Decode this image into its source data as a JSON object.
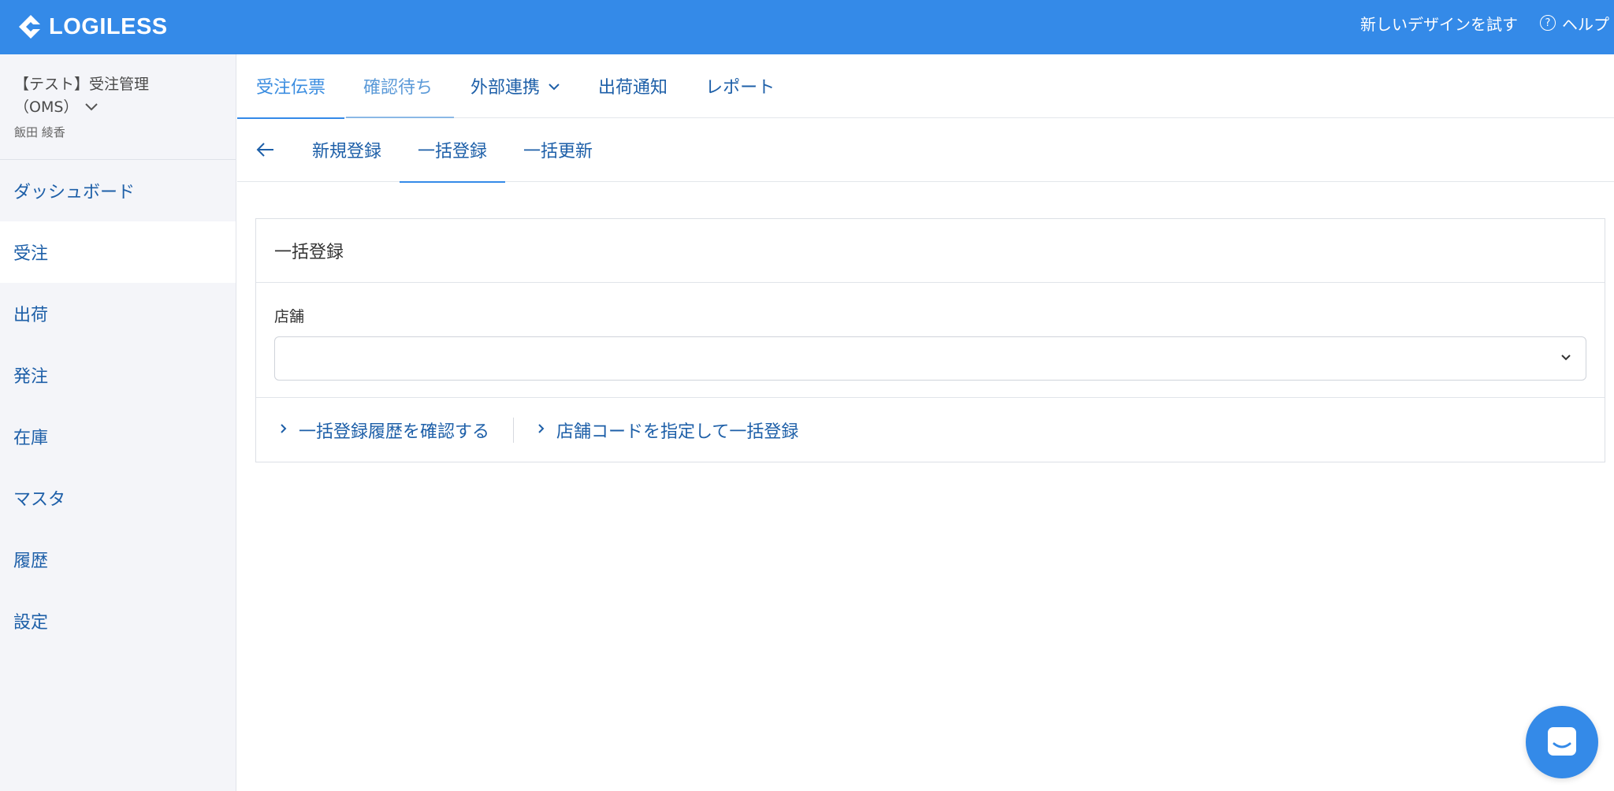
{
  "header": {
    "logo_text": "LOGILESS",
    "try_new_design": "新しいデザインを試す",
    "help_label": "ヘルプ",
    "help_icon": "?"
  },
  "sidebar": {
    "org_line1": "【テスト】受注管理",
    "org_line2": "（OMS）",
    "user": "飯田 綾香",
    "items": [
      {
        "label": "ダッシュボード"
      },
      {
        "label": "受注"
      },
      {
        "label": "出荷"
      },
      {
        "label": "発注"
      },
      {
        "label": "在庫"
      },
      {
        "label": "マスタ"
      },
      {
        "label": "履歴"
      },
      {
        "label": "設定"
      }
    ]
  },
  "tabs": [
    {
      "label": "受注伝票"
    },
    {
      "label": "確認待ち"
    },
    {
      "label": "外部連携"
    },
    {
      "label": "出荷通知"
    },
    {
      "label": "レポート"
    }
  ],
  "subtabs": [
    {
      "label": "新規登録"
    },
    {
      "label": "一括登録"
    },
    {
      "label": "一括更新"
    }
  ],
  "card": {
    "title": "一括登録",
    "store_label": "店舗",
    "store_value": "",
    "links": [
      {
        "label": "一括登録履歴を確認する"
      },
      {
        "label": "店舗コードを指定して一括登録"
      }
    ]
  },
  "colors": {
    "brand": "#348ae8",
    "link": "#1d5fa8"
  }
}
